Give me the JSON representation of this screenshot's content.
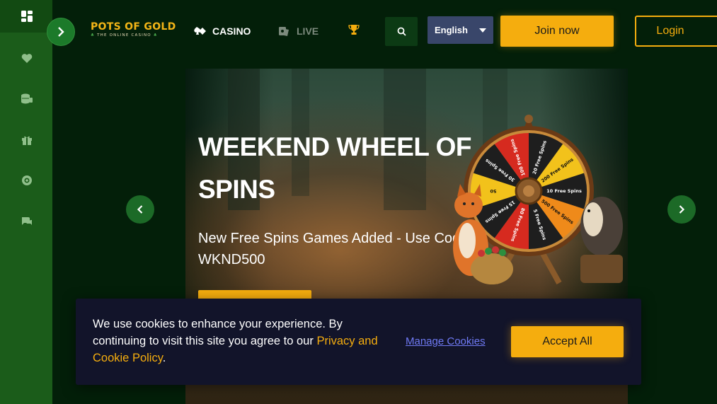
{
  "header": {
    "logo": {
      "main": "POTS OF GOLD",
      "tagline": "THE ONLINE CASINO"
    },
    "nav": {
      "casino": "CASINO",
      "live": "LIVE"
    },
    "language": "English",
    "join_label": "Join now",
    "login_label": "Login"
  },
  "sidebar": {
    "items": [
      "grid-icon",
      "heart-icon",
      "coins-icon",
      "gift-icon",
      "vip-icon",
      "chat-icon"
    ]
  },
  "hero": {
    "title": "WEEKEND WHEEL OF SPINS",
    "subtitle": "New Free Spins Games Added - Use Code WKND500",
    "wheel_segments": [
      "20 Free Spins",
      "200 Free Spins",
      "10 Free Spins",
      "500 Free Spins",
      "5 Free Spins",
      "80 Free Spins",
      "15 Free Spins",
      "50",
      "30 Free Spins",
      "100 Free Spins"
    ]
  },
  "cookie": {
    "text": "We use cookies to enhance your experience. By continuing to visit this site you agree to our ",
    "policy_link": "Privacy and Cookie Policy",
    "text_end": ".",
    "manage_label": "Manage Cookies",
    "accept_label": "Accept All"
  },
  "colors": {
    "accent": "#f5ad0e",
    "sidebar": "#1b5c1a",
    "background": "#031f09",
    "cookie_bg": "#12142a",
    "language_bg": "#39466a"
  }
}
